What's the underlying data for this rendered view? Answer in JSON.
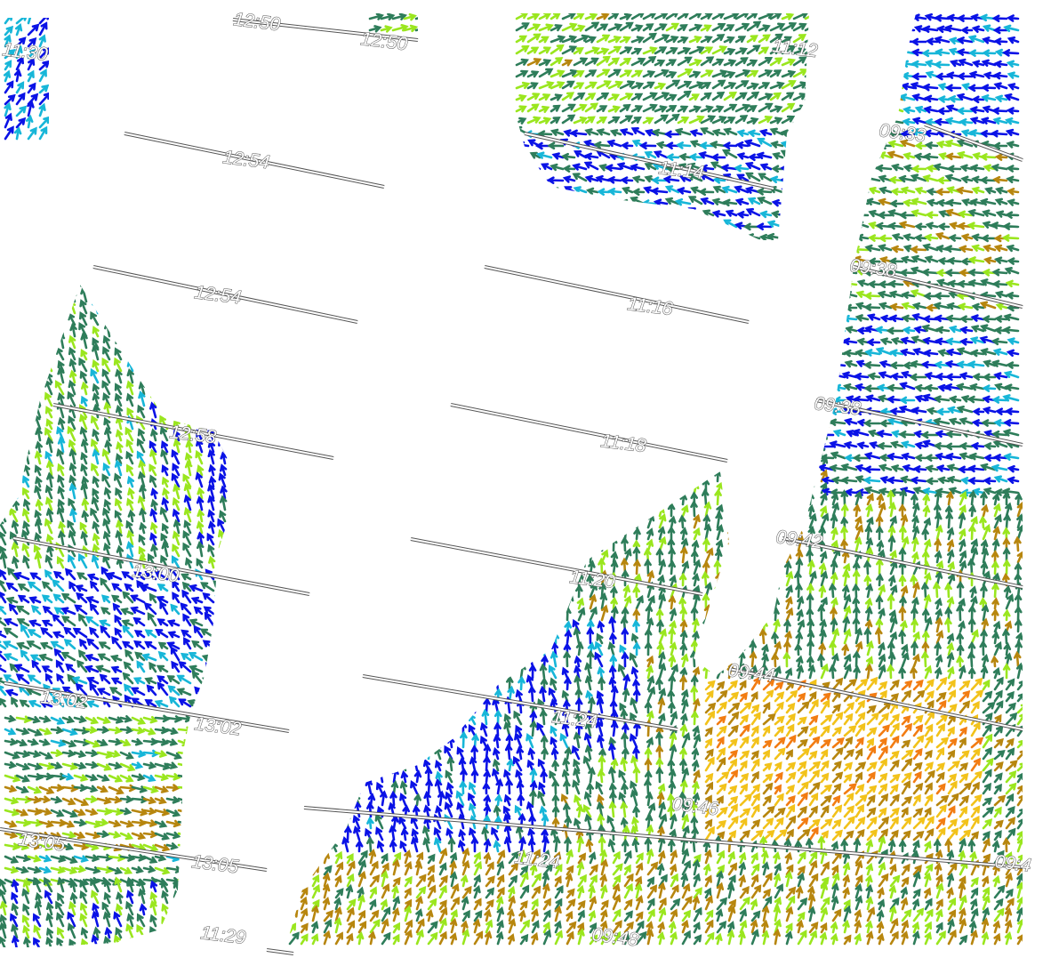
{
  "map": {
    "palette": {
      "deep_blue": "#0a12e6",
      "cyan": "#17b6d8",
      "dark_green": "#2e7d5a",
      "lime": "#9ae61e",
      "brown": "#b7860e",
      "yellow": "#f2c21a",
      "orange": "#f27c12",
      "gray": "#7b7b7b"
    },
    "time_labels": [
      "12:50",
      "12:50",
      "11:12",
      "11:14",
      "09:33",
      "12:54",
      "12:54",
      "11:16",
      "09:38",
      "12:58",
      "11:18",
      "09:38",
      "13:00",
      "11:20",
      "09:42",
      "13:02",
      "13:02",
      "11:24",
      "09:44",
      "13:05",
      "13:05",
      "11:24",
      "09:46",
      "11:29",
      "09:48",
      "11:30",
      "09:4"
    ]
  }
}
